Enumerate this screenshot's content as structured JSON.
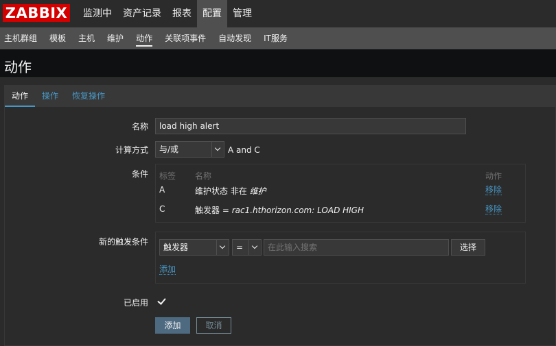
{
  "logo": "ZABBIX",
  "top_menu": [
    {
      "label": "监测中"
    },
    {
      "label": "资产记录"
    },
    {
      "label": "报表"
    },
    {
      "label": "配置"
    },
    {
      "label": "管理"
    }
  ],
  "sub_menu": [
    {
      "label": "主机群组"
    },
    {
      "label": "模板"
    },
    {
      "label": "主机"
    },
    {
      "label": "维护"
    },
    {
      "label": "动作"
    },
    {
      "label": "关联项事件"
    },
    {
      "label": "自动发现"
    },
    {
      "label": "IT服务"
    }
  ],
  "page_title": "动作",
  "tabs": [
    {
      "label": "动作"
    },
    {
      "label": "操作"
    },
    {
      "label": "恢复操作"
    }
  ],
  "form": {
    "name_label": "名称",
    "name_value": "load high alert",
    "calc_label": "计算方式",
    "calc_value": "与/或",
    "calc_expression": "A and C",
    "conditions_label": "条件",
    "conditions": {
      "headers": {
        "tag": "标签",
        "name": "名称",
        "action": "动作"
      },
      "rows": [
        {
          "tag": "A",
          "prefix": "维护状态 非在 ",
          "value": "维护",
          "action": "移除"
        },
        {
          "tag": "C",
          "prefix": "触发器 = ",
          "value": "rac1.hthorizon.com: LOAD HIGH",
          "action": "移除"
        }
      ]
    },
    "new_condition_label": "新的触发条件",
    "new_condition": {
      "type_value": "触发器",
      "operator_value": "=",
      "search_placeholder": "在此输入搜索",
      "select_button": "选择",
      "add_link": "添加"
    },
    "enabled_label": "已启用",
    "enabled": true,
    "submit_button": "添加",
    "cancel_button": "取消"
  }
}
